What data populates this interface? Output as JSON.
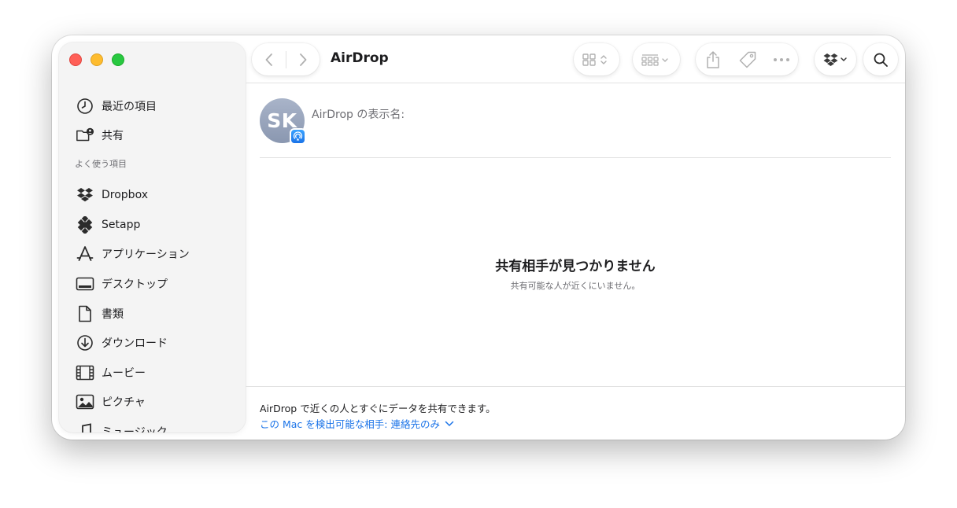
{
  "window": {
    "title": "AirDrop"
  },
  "sidebar": {
    "top_items": [
      {
        "label": "最近の項目",
        "icon": "clock-icon"
      },
      {
        "label": "共有",
        "icon": "shared-folder-icon"
      }
    ],
    "section_label": "よく使う項目",
    "favorites": [
      {
        "label": "Dropbox",
        "icon": "dropbox-icon"
      },
      {
        "label": "Setapp",
        "icon": "setapp-icon"
      },
      {
        "label": "アプリケーション",
        "icon": "applications-icon"
      },
      {
        "label": "デスクトップ",
        "icon": "desktop-icon"
      },
      {
        "label": "書類",
        "icon": "document-icon"
      },
      {
        "label": "ダウンロード",
        "icon": "download-icon"
      },
      {
        "label": "ムービー",
        "icon": "film-icon"
      },
      {
        "label": "ピクチャ",
        "icon": "photo-icon"
      },
      {
        "label": "ミュージック",
        "icon": "music-icon"
      }
    ]
  },
  "content": {
    "avatar_initials": "SK",
    "name_label": "AirDrop の表示名:",
    "empty_title": "共有相手が見つかりません",
    "empty_subtitle": "共有可能な人が近くにいません。",
    "footer_description": "AirDrop で近くの人とすぐにデータを共有できます。",
    "discoverable_label": "この Mac を検出可能な相手: 連絡先のみ"
  },
  "colors": {
    "accent": "#1a73e8",
    "close": "#ff5f57",
    "minimize": "#febc2e",
    "zoom": "#28c840",
    "sidebar_bg": "#f4f4f4"
  }
}
